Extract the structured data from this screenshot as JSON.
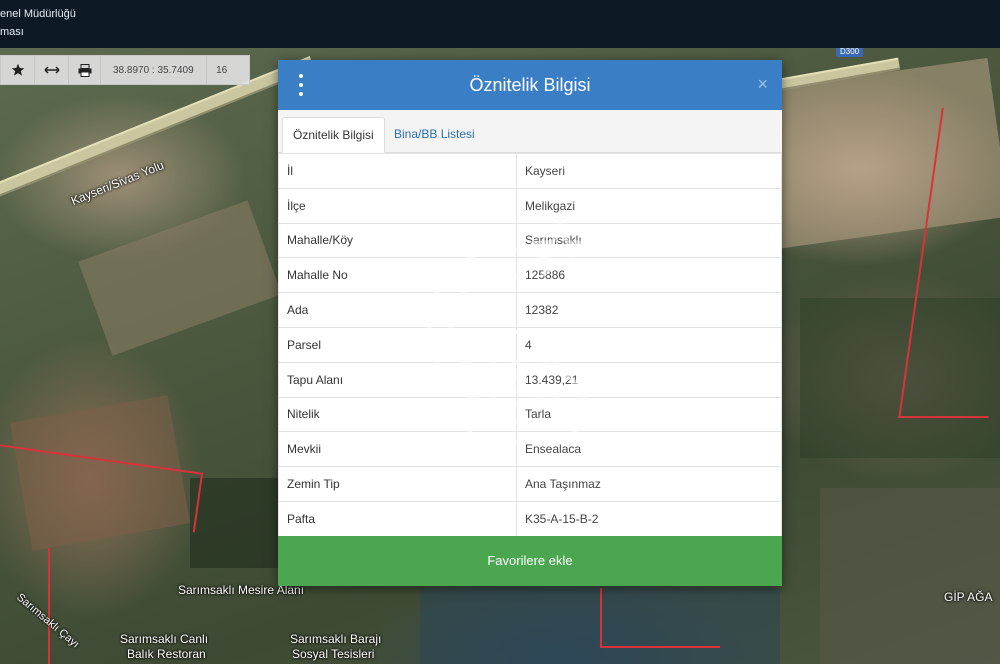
{
  "header": {
    "line1": "enel Müdürlüğü",
    "line2": "ması"
  },
  "toolbar": {
    "coordinates": "38.8970 : 35.7409",
    "zoom": "16"
  },
  "map": {
    "road_label": "Kayseri/Sivas Yolu",
    "highway_sign": "D300",
    "labels": {
      "sarimsakli_cayi": "Sarımsaklı Çayı",
      "mesire": "Sarımsaklı Mesire Alanı",
      "restoran_line1": "Sarımsaklı Canlı",
      "restoran_line2": "Balık Restoran",
      "baraj_line1": "Sarımsaklı Barajı",
      "baraj_line2": "Sosyal Tesisleri",
      "gip": "GİP AĞA"
    }
  },
  "modal": {
    "title": "Öznitelik Bilgisi",
    "close_symbol": "×",
    "tabs": [
      {
        "label": "Öznitelik Bilgisi",
        "active": true
      },
      {
        "label": "Bina/BB Listesi",
        "active": false
      }
    ],
    "rows": [
      {
        "key": "İl",
        "value": "Kayseri"
      },
      {
        "key": "İlçe",
        "value": "Melikgazi"
      },
      {
        "key": "Mahalle/Köy",
        "value": "Sarımsaklı"
      },
      {
        "key": "Mahalle No",
        "value": "125886"
      },
      {
        "key": "Ada",
        "value": "12382"
      },
      {
        "key": "Parsel",
        "value": "4"
      },
      {
        "key": "Tapu Alanı",
        "value": "13.439,21"
      },
      {
        "key": "Nitelik",
        "value": "Tarla"
      },
      {
        "key": "Mevkii",
        "value": "Ensealaca"
      },
      {
        "key": "Zemin Tip",
        "value": "Ana Taşınmaz"
      },
      {
        "key": "Pafta",
        "value": "K35-A-15-B-2"
      }
    ],
    "favorite_button": "Favorilere ekle"
  },
  "watermark": {
    "mark": "SM"
  },
  "colors": {
    "modal_header": "#3a7fc5",
    "favorite_button": "#4aa74f",
    "topbar": "#0d1a26",
    "parcel_border": "#d8333b"
  }
}
